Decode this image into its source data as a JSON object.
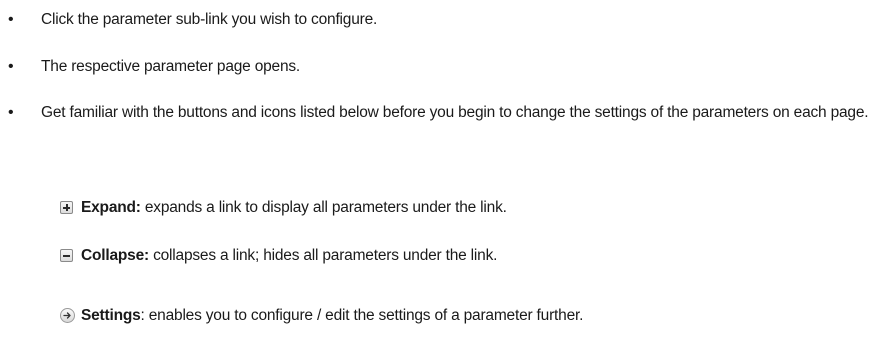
{
  "bullets": [
    {
      "symbol": "•",
      "text": "Click the parameter sub-link you wish to configure."
    },
    {
      "symbol": "•",
      "text": "The respective parameter page opens."
    },
    {
      "symbol": "•",
      "text": "Get familiar with the buttons and icons listed below before you begin to change the settings of the parameters on each page."
    }
  ],
  "icons": [
    {
      "icon": "expand-icon",
      "term": "Expand:",
      "description": " expands a link to display all parameters under the link."
    },
    {
      "icon": "collapse-icon",
      "term": "Collapse:",
      "description": " collapses a link; hides all parameters under the link."
    },
    {
      "icon": "settings-arrow-icon",
      "term": "Settings",
      "description": ": enables you to configure / edit the settings of a parameter further."
    }
  ]
}
